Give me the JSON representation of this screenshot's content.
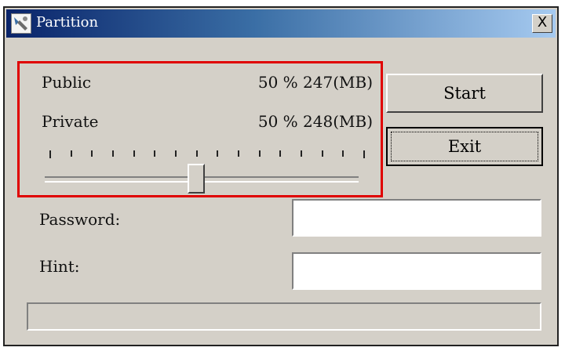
{
  "window": {
    "title": "Partition",
    "close_label": "X"
  },
  "partition": {
    "public": {
      "label": "Public",
      "value": "50 % 247(MB)"
    },
    "private": {
      "label": "Private",
      "value": "50 % 248(MB)"
    },
    "slider": {
      "public_percent": 50,
      "tick_count": 16
    }
  },
  "buttons": {
    "start": "Start",
    "exit": "Exit"
  },
  "form": {
    "password": {
      "label": "Password:",
      "value": ""
    },
    "hint": {
      "label": "Hint:",
      "value": ""
    }
  },
  "progress": {
    "fraction": 0
  },
  "colors": {
    "titlebar_start": "#0a246a",
    "titlebar_end": "#a6caf0",
    "highlight_box": "#e00000",
    "window_face": "#d4d0c8"
  },
  "icons": {
    "app": "partition-app-icon",
    "close": "close-icon"
  }
}
